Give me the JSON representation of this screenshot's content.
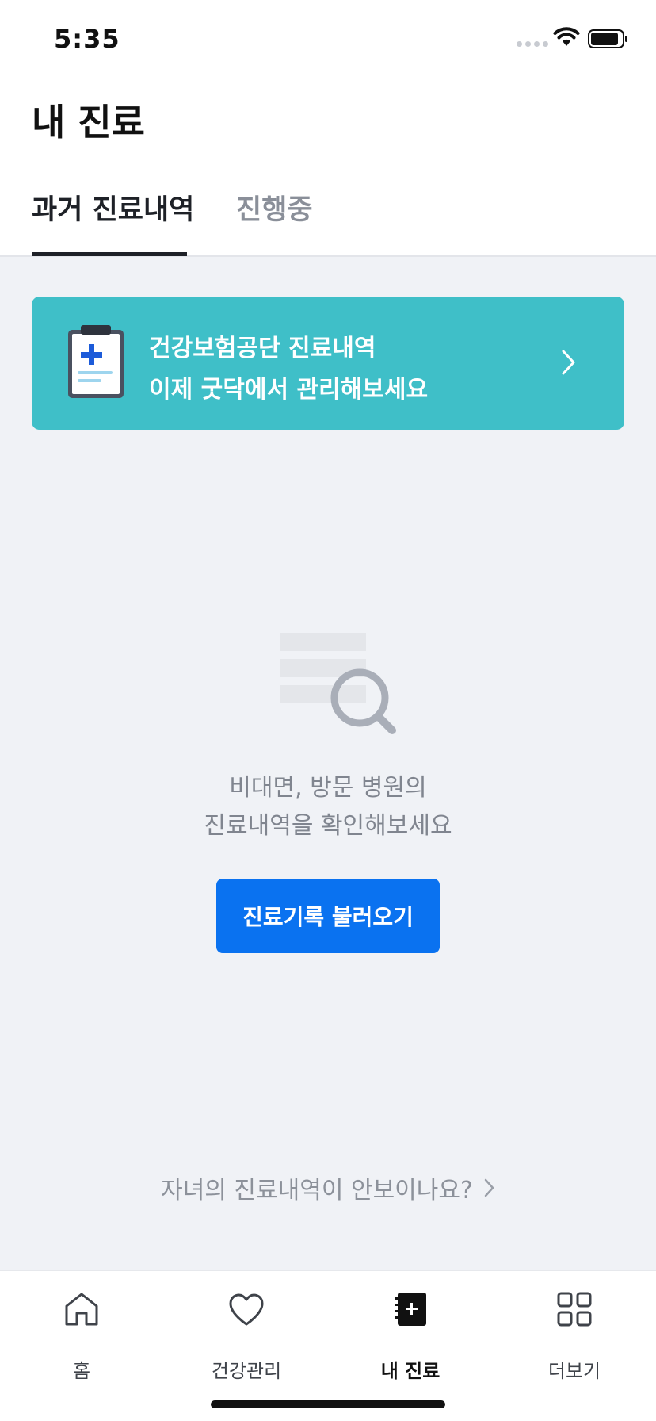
{
  "status_bar": {
    "time": "5:35"
  },
  "header": {
    "title": "내 진료"
  },
  "tabs": [
    {
      "label": "과거 진료내역",
      "active": true
    },
    {
      "label": "진행중",
      "active": false
    }
  ],
  "banner": {
    "line1": "건강보험공단 진료내역",
    "line2": "이제 굿닥에서 관리해보세요",
    "icon": "clipboard-medical-icon",
    "color": "#3FBFC8"
  },
  "empty_state": {
    "line1": "비대면, 방문 병원의",
    "line2": "진료내역을 확인해보세요",
    "button_label": "진료기록 불러오기",
    "button_color": "#0A72F0"
  },
  "child_link": {
    "label": "자녀의 진료내역이 안보이나요?"
  },
  "bottom_nav": {
    "items": [
      {
        "label": "홈",
        "icon": "home-icon",
        "active": false
      },
      {
        "label": "건강관리",
        "icon": "heart-icon",
        "active": false
      },
      {
        "label": "내 진료",
        "icon": "medical-record-icon",
        "active": true
      },
      {
        "label": "더보기",
        "icon": "grid-icon",
        "active": false
      }
    ]
  }
}
